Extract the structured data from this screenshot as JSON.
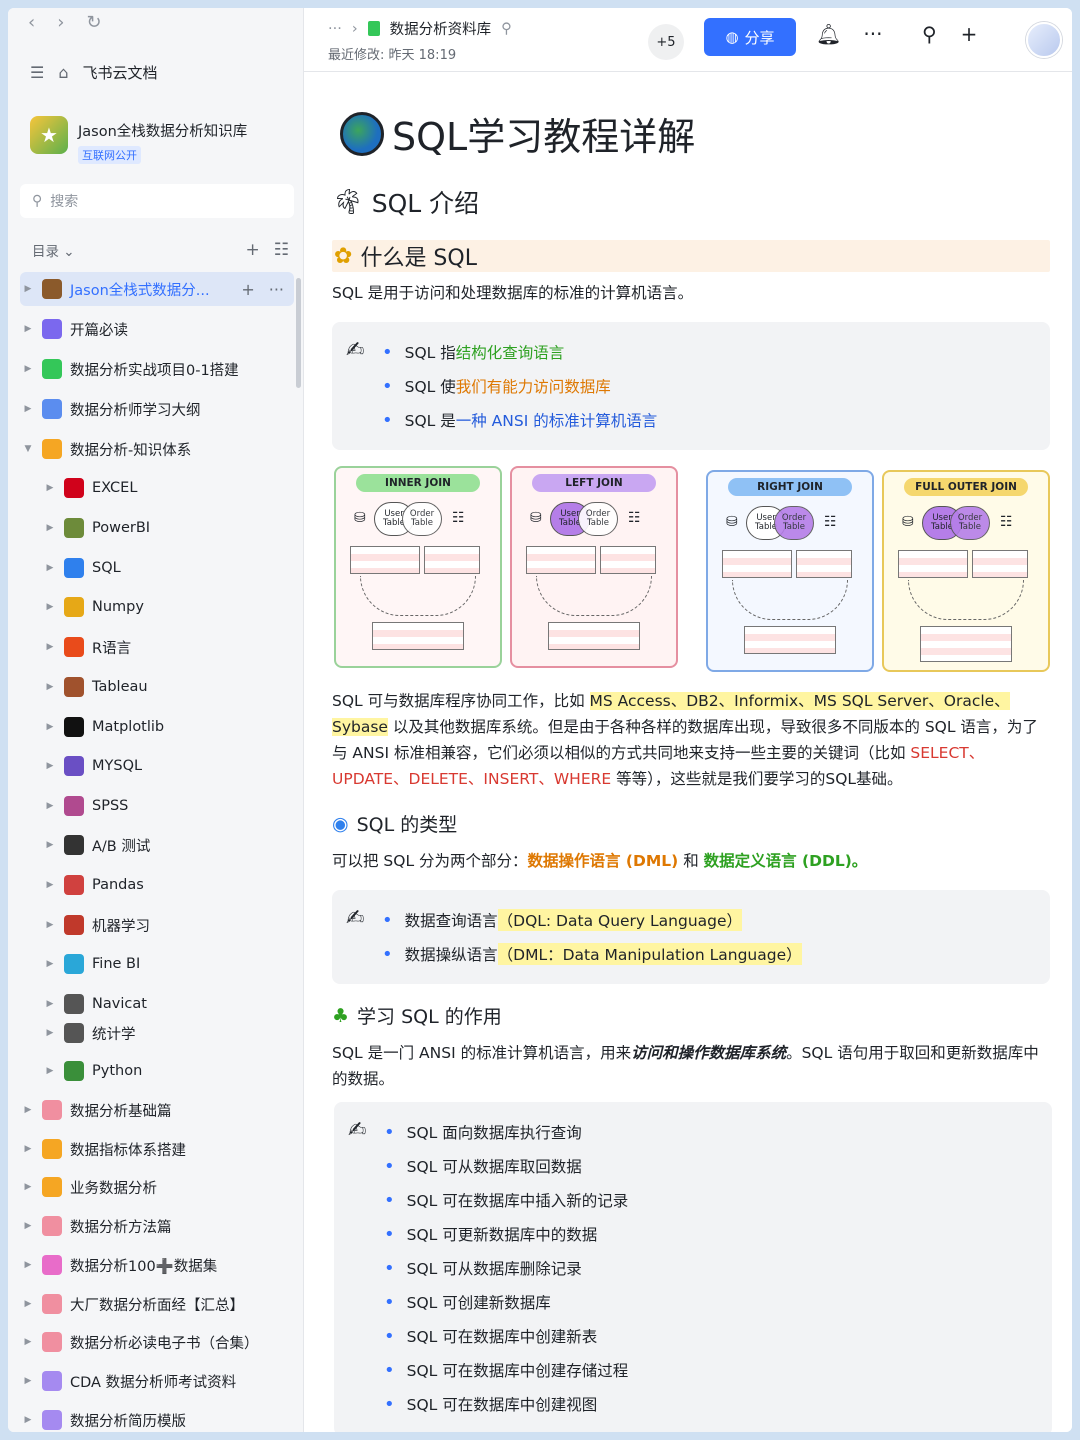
{
  "sidebar": {
    "home_label": "飞书云文档",
    "kb_title": "Jason全栈数据分析知识库",
    "kb_badge": "互联网公开",
    "search_placeholder": "搜索",
    "toc_label": "目录",
    "items": [
      {
        "label": "Jason全栈式数据分...",
        "color": "#8b5a2b"
      },
      {
        "label": "开篇必读",
        "color": "#7b68ee"
      },
      {
        "label": "数据分析实战项目0-1搭建",
        "color": "#34c759"
      },
      {
        "label": "数据分析师学习大纲",
        "color": "#5b8def"
      },
      {
        "label": "数据分析-知识体系",
        "color": "#f5a623"
      },
      {
        "label": "EXCEL",
        "color": "#d0021b"
      },
      {
        "label": "PowerBI",
        "color": "#6d8b3a"
      },
      {
        "label": "SQL",
        "color": "#2f80ed"
      },
      {
        "label": "Numpy",
        "color": "#e6a817"
      },
      {
        "label": "R语言",
        "color": "#e94b1b"
      },
      {
        "label": "Tableau",
        "color": "#a0522d"
      },
      {
        "label": "Matplotlib",
        "color": "#111111"
      },
      {
        "label": "MYSQL",
        "color": "#6a4fc4"
      },
      {
        "label": "SPSS",
        "color": "#b04a8f"
      },
      {
        "label": "A/B 测试",
        "color": "#333333"
      },
      {
        "label": "Pandas",
        "color": "#d0413f"
      },
      {
        "label": "机器学习",
        "color": "#c0392b"
      },
      {
        "label": "Fine BI",
        "color": "#2aa7d8"
      },
      {
        "label": "Navicat",
        "color": "#555555"
      },
      {
        "label": "统计学",
        "color": "#555555"
      },
      {
        "label": "Python",
        "color": "#3a8f3a"
      },
      {
        "label": "数据分析基础篇",
        "color": "#f08fa0"
      },
      {
        "label": "数据指标体系搭建",
        "color": "#f5a623"
      },
      {
        "label": "业务数据分析",
        "color": "#f5a623"
      },
      {
        "label": "数据分析方法篇",
        "color": "#f08fa0"
      },
      {
        "label": "数据分析100➕数据集",
        "color": "#e86cc9"
      },
      {
        "label": "大厂数据分析面经【汇总】",
        "color": "#f08fa0"
      },
      {
        "label": "数据分析必读电子书（合集）",
        "color": "#f08fa0"
      },
      {
        "label": "CDA 数据分析师考试资料",
        "color": "#a58af0"
      },
      {
        "label": "数据分析简历模版",
        "color": "#a58af0"
      }
    ]
  },
  "topbar": {
    "breadcrumb_more": "···",
    "breadcrumb_doc": "数据分析资料库",
    "modified": "最近修改: 昨天 18:19",
    "collab_count": "+5",
    "share_label": "分享"
  },
  "doc": {
    "title": "SQL学习教程详解",
    "h_intro": "SQL 介绍",
    "h_what": "什么是 SQL",
    "p_def": "SQL 是用于访问和处理数据库的标准的计算机语言。",
    "callout1": [
      {
        "pre": "SQL 指",
        "em": "结构化查询语言",
        "cls": "green"
      },
      {
        "pre": "SQL 使",
        "em": "我们有能力访问数据库",
        "cls": "orange"
      },
      {
        "pre": "SQL 是",
        "em": "一种 ANSI 的标准计算机语言",
        "cls": "blue"
      }
    ],
    "joins": [
      {
        "title": "INNER JOIN",
        "color": "#9be29b"
      },
      {
        "title": "LEFT JOIN",
        "color": "#c9a7f2"
      },
      {
        "title": "RIGHT JOIN",
        "color": "#8fc1f5"
      },
      {
        "title": "FULL OUTER JOIN",
        "color": "#f5d76e"
      }
    ],
    "join_labels": {
      "user": "User Table",
      "order": "Order Table"
    },
    "p_compat_1": "SQL 可与数据库程序协同工作，比如 ",
    "p_compat_hl": "MS Access、DB2、Informix、MS SQL Server、Oracle、Sybase",
    "p_compat_2": " 以及其他数据库系统。但是由于各种各样的数据库出现，导致很多不同版本的 SQL 语言，为了与 ANSI 标准相兼容，它们必须以相似的方式共同地来支持一些主要的关键词（比如 ",
    "p_compat_kw": "SELECT、UPDATE、DELETE、INSERT、WHERE",
    "p_compat_3": " 等等），这些就是我们要学习的SQL基础。",
    "h_types": "SQL 的类型",
    "p_types_1": "可以把 SQL 分为两个部分：",
    "p_types_dml": "数据操作语言 (DML)",
    "p_types_and": " 和 ",
    "p_types_ddl": "数据定义语言 (DDL)。",
    "callout2": [
      {
        "pre": "数据查询语言",
        "hl": "（DQL: Data Query Language）"
      },
      {
        "pre": "数据操纵语言",
        "hl": "（DML：Data Manipulation Language）"
      }
    ],
    "h_use": "学习 SQL 的作用",
    "p_use_1": "SQL 是一门 ANSI 的标准计算机语言，用来",
    "p_use_em": "访问和操作数据库系统",
    "p_use_2": "。SQL 语句用于取回和更新数据库中的数据。",
    "callout3": [
      "SQL 面向数据库执行查询",
      "SQL 可从数据库取回数据",
      "SQL 可在数据库中插入新的记录",
      "SQL 可更新数据库中的数据",
      "SQL 可从数据库删除记录",
      "SQL 可创建新数据库",
      "SQL 可在数据库中创建新表",
      "SQL 可在数据库中创建存储过程",
      "SQL 可在数据库中创建视图"
    ]
  }
}
